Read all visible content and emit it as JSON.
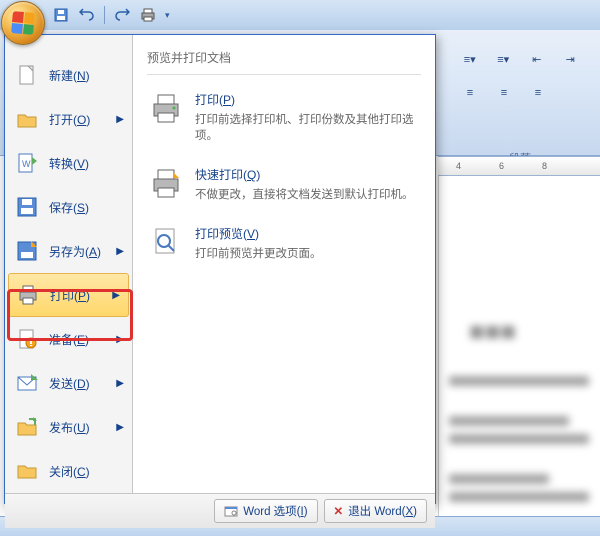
{
  "qat": {
    "save_tip": "保存",
    "undo_tip": "撤销",
    "redo_tip": "恢复",
    "print_tip": "快速打印"
  },
  "menu": {
    "items": [
      {
        "label": "新建(<u>N</u>)",
        "icon": "new-doc"
      },
      {
        "label": "打开(<u>O</u>)",
        "icon": "open-folder",
        "arrow": true
      },
      {
        "label": "转换(<u>V</u>)",
        "icon": "convert"
      },
      {
        "label": "保存(<u>S</u>)",
        "icon": "save-disk"
      },
      {
        "label": "另存为(<u>A</u>)",
        "icon": "save-as",
        "arrow": true
      },
      {
        "label": "打印(<u>P</u>)",
        "icon": "print",
        "arrow": true,
        "highlighted": true
      },
      {
        "label": "准备(<u>E</u>)",
        "icon": "prepare",
        "arrow": true
      },
      {
        "label": "发送(<u>D</u>)",
        "icon": "send",
        "arrow": true
      },
      {
        "label": "发布(<u>U</u>)",
        "icon": "publish",
        "arrow": true
      },
      {
        "label": "关闭(<u>C</u>)",
        "icon": "close-folder"
      }
    ],
    "right_title": "预览并打印文档",
    "submenu": [
      {
        "title": "打印(<u>P</u>)",
        "desc": "打印前选择打印机、打印份数及其他打印选项。",
        "icon": "printer"
      },
      {
        "title": "快速打印(<u>Q</u>)",
        "desc": "不做更改，直接将文档发送到默认打印机。",
        "icon": "quick-print"
      },
      {
        "title": "打印预览(<u>V</u>)",
        "desc": "打印前预览并更改页面。",
        "icon": "preview"
      }
    ],
    "footer": {
      "options": "Word 选项(<u>I</u>)",
      "exit": "退出 Word(<u>X</u>)"
    }
  },
  "ribbon": {
    "group_label": "段落"
  },
  "ruler": {
    "marks": [
      "4",
      "6",
      "8"
    ]
  },
  "status": {
    "left1": "",
    "left2": ""
  }
}
